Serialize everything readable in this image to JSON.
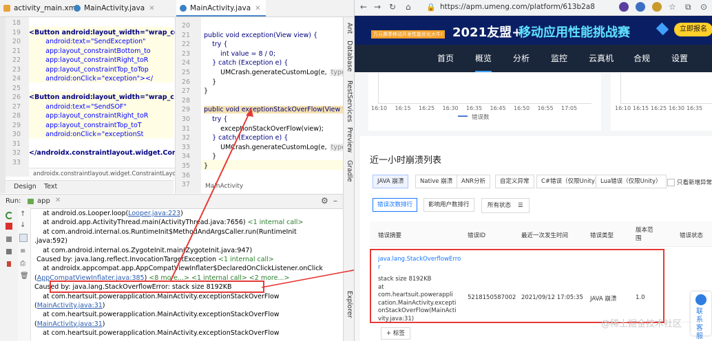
{
  "ide": {
    "tabs": [
      {
        "label": "activity_main.xml"
      },
      {
        "label": "MainActivity.java"
      },
      {
        "label": "MainActivity.java"
      }
    ],
    "xml": {
      "lines": [
        {
          "n": "18",
          "text": ""
        },
        {
          "n": "19",
          "text": "<Button android:layout_width=\"wrap_con"
        },
        {
          "n": "20",
          "text": "        android:text=\"SendException\""
        },
        {
          "n": "21",
          "text": "        app:layout_constraintBottom_to"
        },
        {
          "n": "22",
          "text": "        app:layout_constraintRight_toR"
        },
        {
          "n": "23",
          "text": "        app:layout_constraintTop_toTop"
        },
        {
          "n": "24",
          "text": "        android:onClick=\"exception\"></"
        },
        {
          "n": "25",
          "text": ""
        },
        {
          "n": "26",
          "text": "<Button android:layout_width=\"wrap_c"
        },
        {
          "n": "27",
          "text": "        android:text=\"SendSOF\""
        },
        {
          "n": "28",
          "text": "        app:layout_constraintRight_toR"
        },
        {
          "n": "29",
          "text": "        app:layout_constraintTop_toT"
        },
        {
          "n": "30",
          "text": "        android:onClick=\"exceptionSt"
        },
        {
          "n": "31",
          "text": ""
        },
        {
          "n": "32",
          "text": "</androidx.constraintlayout.widget.Constra"
        },
        {
          "n": "33",
          "text": ""
        }
      ],
      "breadcrumb": "androidx.constraintlayout.widget.ConstraintLayout",
      "design_tab": "Design",
      "text_tab": "Text"
    },
    "java": {
      "lines": [
        {
          "n": "20",
          "text": ""
        },
        {
          "n": "21",
          "text": "public void exception(View view) {"
        },
        {
          "n": "22",
          "text": "    try {"
        },
        {
          "n": "23",
          "text": "        int value = 8 / 0;"
        },
        {
          "n": "24",
          "text": "    } catch (Exception e) {"
        },
        {
          "n": "25",
          "text": "        UMCrash.generateCustomLog(e,"
        },
        {
          "n": "26",
          "text": "    }"
        },
        {
          "n": "27",
          "text": "}"
        },
        {
          "n": "28",
          "text": ""
        },
        {
          "n": "29",
          "text": "public void exceptionStackOverFlow(View v"
        },
        {
          "n": "30",
          "text": "    try {"
        },
        {
          "n": "31",
          "text": "        exceptionStackOverFlow(view);"
        },
        {
          "n": "32",
          "text": "    } catch (Exception e) {"
        },
        {
          "n": "33",
          "text": "        UMCrash.generateCustomLog(e,"
        },
        {
          "n": "34",
          "text": "    }"
        },
        {
          "n": "35",
          "text": "}"
        },
        {
          "n": "36",
          "text": ""
        },
        {
          "n": "37",
          "text": ""
        }
      ],
      "hint": "type",
      "breadcrumb": "MainActivity"
    },
    "side_tools": [
      "Ant",
      "Database",
      "RestServices",
      "Preview",
      "Gradle"
    ],
    "device_explorer": "Device File Explorer",
    "run": {
      "label": "Run:",
      "config": "app",
      "lines": [
        {
          "text": "    at android.os.Looper.loop(",
          "link": "Looper.java:223",
          "tail": ")"
        },
        {
          "text": "    at android.app.ActivityThread.main(ActivityThread.java:7656) ",
          "grey": "<1 internal call>"
        },
        {
          "text": "    at com.android.internal.os.RuntimeInit$MethodAndArgsCaller.run(RuntimeInit"
        },
        {
          "text": ".java:592)"
        },
        {
          "text": "    at com.android.internal.os.ZygoteInit.main(ZygoteInit.java:947)"
        },
        {
          "text": " Caused by: java.lang.reflect.InvocationTargetException ",
          "grey": "<1 internal call>"
        },
        {
          "text": "    at androidx.appcompat.app.AppCompatViewInflater$DeclaredOnClickListener.onClick"
        },
        {
          "text": "(",
          "link": "AppCompatViewInflater.java:385",
          "tail": ") ",
          "grey": "<8 more...> <1 internal call> <2 more...>"
        },
        {
          "text": "Caused by: java.lang.StackOverflowError: stack size 8192KB"
        },
        {
          "text": "    at com.heartsuit.powerapplication.MainActivity.exceptionStackOverFlow"
        },
        {
          "text": "(",
          "link": "MainActivity.java:31",
          "tail": ")"
        },
        {
          "text": "    at com.heartsuit.powerapplication.MainActivity.exceptionStackOverFlow"
        },
        {
          "text": "(",
          "link": "MainActivity.java:31",
          "tail": ")"
        },
        {
          "text": "    at com.heartsuit.powerapplication.MainActivity.exceptionStackOverFlow"
        }
      ]
    }
  },
  "browser": {
    "url": "https://apm.umeng.com/platform/613b2a8",
    "banner": {
      "small": "万元赛季移动开发性能优化大牛!",
      "title": "2021友盟+",
      "subtitle": "移动应用性能挑战赛",
      "cta": "立即报名"
    },
    "nav": [
      "首页",
      "概览",
      "分析",
      "监控",
      "云真机",
      "合规",
      "设置"
    ],
    "nav_active": 1,
    "chart": {
      "ticks_left": [
        "16:10",
        "16:15",
        "16:25",
        "16:30",
        "16:35",
        "16:45",
        "16:50",
        "16:55",
        "17:05"
      ],
      "ticks_right": [
        "16:10",
        "16:15",
        "16:25",
        "16:30",
        "16:35"
      ],
      "legend": "错误数"
    },
    "crash": {
      "title": "近一小时崩溃列表",
      "tabs": [
        "JAVA 崩溃",
        "Native 崩溃",
        "ANR分析",
        "自定义异常",
        "C#错误（仅限Unity）",
        "Lua错误（仅限Unity）"
      ],
      "only_new": "只看新增异常",
      "sort": [
        "错误次数排行",
        "影响用户数排行"
      ],
      "status": "所有状态",
      "headers": [
        "错误摘要",
        "错误ID",
        "最近一次发生时间",
        "错误类型",
        "版本范围",
        "错误状态"
      ],
      "row": {
        "summary_link": [
          "java.lang.StackOverflowErro",
          "r"
        ],
        "summary_lines": [
          "stack size 8192KB",
          "at com.heartsuit.powerappli",
          "cation.MainActivity.excepti",
          "onStackOverFlow(MainActi",
          "vity.java:31)"
        ],
        "id": "5218150587002",
        "time": "2021/09/12 17:05:35",
        "type": "JAVA 崩溃",
        "version": "1.0"
      },
      "tag_button": "+ 标签",
      "watermark": "@稀土掘金技术社区",
      "side_button": "联系客服"
    }
  },
  "colors": {
    "accent": "#4a88c7",
    "red": "#e53935",
    "banner": "#0a1f63",
    "nav": "#1a2639",
    "link": "#1677ff"
  }
}
